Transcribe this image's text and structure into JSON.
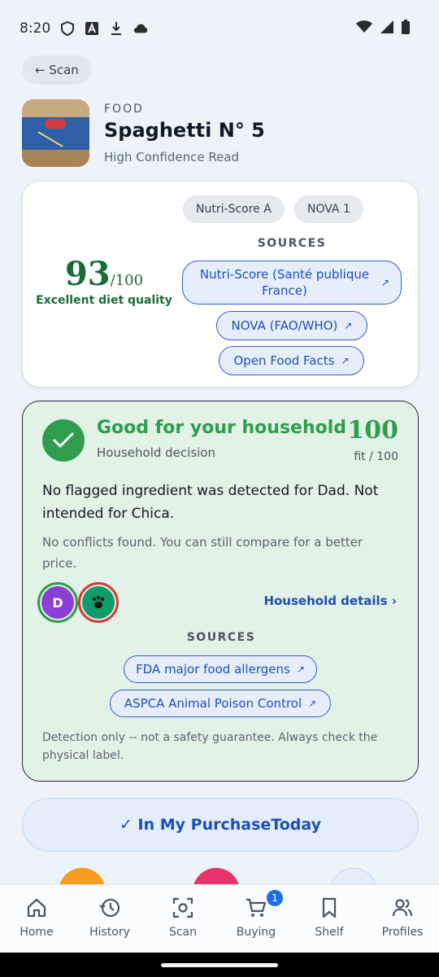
{
  "status_bar": {
    "time": "8:20"
  },
  "nav_back": {
    "label": "← Scan"
  },
  "product": {
    "category": "FOOD",
    "name": "Spaghetti N° 5",
    "confidence": "High Confidence Read"
  },
  "nutrition": {
    "chips": [
      "Nutri-Score A",
      "NOVA 1"
    ],
    "score": "93",
    "score_suffix": "/100",
    "quality": "Excellent diet quality",
    "sources_title": "SOURCES",
    "sources": [
      "Nutri-Score (Santé publique France)",
      "NOVA (FAO/WHO)",
      "Open Food Facts"
    ]
  },
  "household": {
    "verdict": "Good for your household",
    "decision_label": "Household decision",
    "fit_score": "100",
    "fit_label": "fit / 100",
    "message": "No flagged ingredient was detected for Dad. Not intended for Chica.",
    "note": "No conflicts found. You can still compare for a better price.",
    "avatars": [
      {
        "initial": "D",
        "color": "#8b3fd6",
        "ring": "#2e9e4e"
      },
      {
        "initial": "🐾",
        "color": "#119a6a",
        "ring": "#d33c3c"
      }
    ],
    "details_link": "Household details ›",
    "sources_title": "SOURCES",
    "sources": [
      "FDA major food allergens",
      "ASPCA Animal Poison Control"
    ],
    "disclaimer": "Detection only -- not a safety guarantee. Always check the physical label."
  },
  "purchase_button": {
    "label": "✓ In My PurchaseToday"
  },
  "bottom_nav": {
    "items": [
      {
        "label": "Home",
        "icon": "home-icon"
      },
      {
        "label": "History",
        "icon": "history-icon"
      },
      {
        "label": "Scan",
        "icon": "scan-icon"
      },
      {
        "label": "Buying",
        "icon": "cart-icon",
        "badge": "1"
      },
      {
        "label": "Shelf",
        "icon": "bookmark-icon"
      },
      {
        "label": "Profiles",
        "icon": "people-icon"
      }
    ]
  },
  "colors": {
    "accent_blue": "#1d4fb8",
    "good_green": "#2e9e4e",
    "card_green_bg": "#e3f2e6"
  }
}
